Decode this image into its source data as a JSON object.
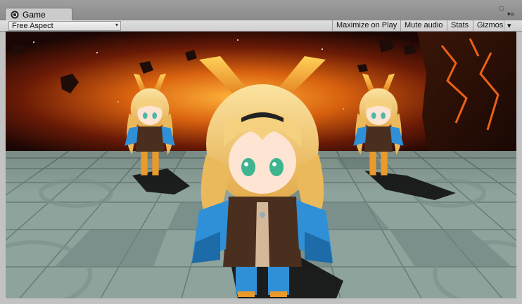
{
  "window": {
    "tab_label": "Game",
    "tab_icon": "unity-logo-icon",
    "controls": {
      "maximize": "□",
      "menu": "▾≡"
    }
  },
  "toolbar": {
    "aspect_label": "Free Aspect",
    "aspect_arrow": "▾",
    "maximize_on_play": "Maximize on Play",
    "mute_audio": "Mute audio",
    "stats": "Stats",
    "gizmos": "Gizmos",
    "gizmos_arrow": "▾"
  },
  "colors": {
    "sky_dark": "#1a0604",
    "sky_fire": "#d9620f",
    "floor_light": "#9fb2ab",
    "floor_dark": "#6c827c",
    "hair": "#f2c766",
    "ears": "#f0a43a",
    "jacket_blue": "#2f90d8",
    "vest_brown": "#4a2f1e"
  }
}
